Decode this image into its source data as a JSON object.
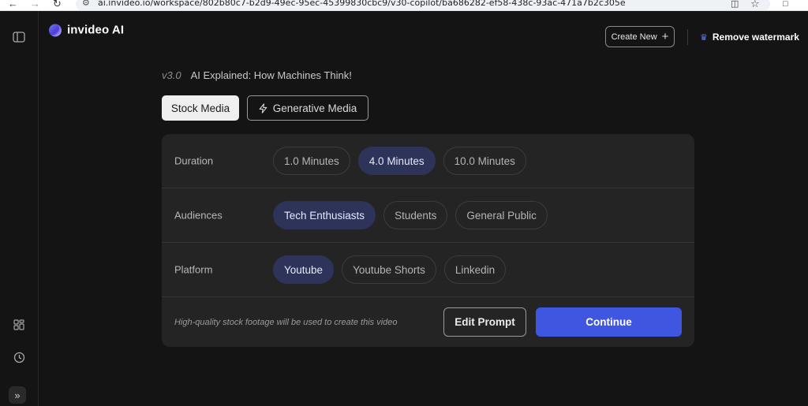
{
  "browser": {
    "url": "ai.invideo.io/workspace/802b80c7-b2d9-49ec-95ec-45399830cbc9/v30-copilot/ba686282-ef58-438c-93ac-471a7b2c305e",
    "icons": [
      "back-icon",
      "forward-icon",
      "reload-icon",
      "site-info-icon",
      "install-app-icon",
      "bookmark-star-icon",
      "extensions-icon"
    ]
  },
  "sidebar": {
    "icons": [
      "panel-toggle-icon",
      "apps-grid-icon",
      "history-clock-icon",
      "expand-chevrons-icon"
    ]
  },
  "header": {
    "logo_text": "invideo AI",
    "create_new_label": "Create New",
    "remove_watermark_label": "Remove watermark",
    "accent_color": "#5b7bff"
  },
  "project": {
    "version": "v3.0",
    "title": "AI Explained: How Machines Think!"
  },
  "media_tabs": [
    {
      "label": "Stock Media",
      "selected": true
    },
    {
      "label": "Generative Media",
      "selected": false
    }
  ],
  "settings": {
    "duration": {
      "label": "Duration",
      "options": [
        {
          "label": "1.0 Minutes",
          "selected": false
        },
        {
          "label": "4.0 Minutes",
          "selected": true
        },
        {
          "label": "10.0 Minutes",
          "selected": false
        }
      ]
    },
    "audiences": {
      "label": "Audiences",
      "options": [
        {
          "label": "Tech Enthusiasts",
          "selected": true
        },
        {
          "label": "Students",
          "selected": false
        },
        {
          "label": "General Public",
          "selected": false
        }
      ]
    },
    "platform": {
      "label": "Platform",
      "options": [
        {
          "label": "Youtube",
          "selected": true
        },
        {
          "label": "Youtube Shorts",
          "selected": false
        },
        {
          "label": "Linkedin",
          "selected": false
        }
      ]
    }
  },
  "footer": {
    "note": "High-quality stock footage will be used to create this video",
    "edit_prompt_label": "Edit Prompt",
    "continue_label": "Continue",
    "continue_color": "#3f57e0"
  }
}
